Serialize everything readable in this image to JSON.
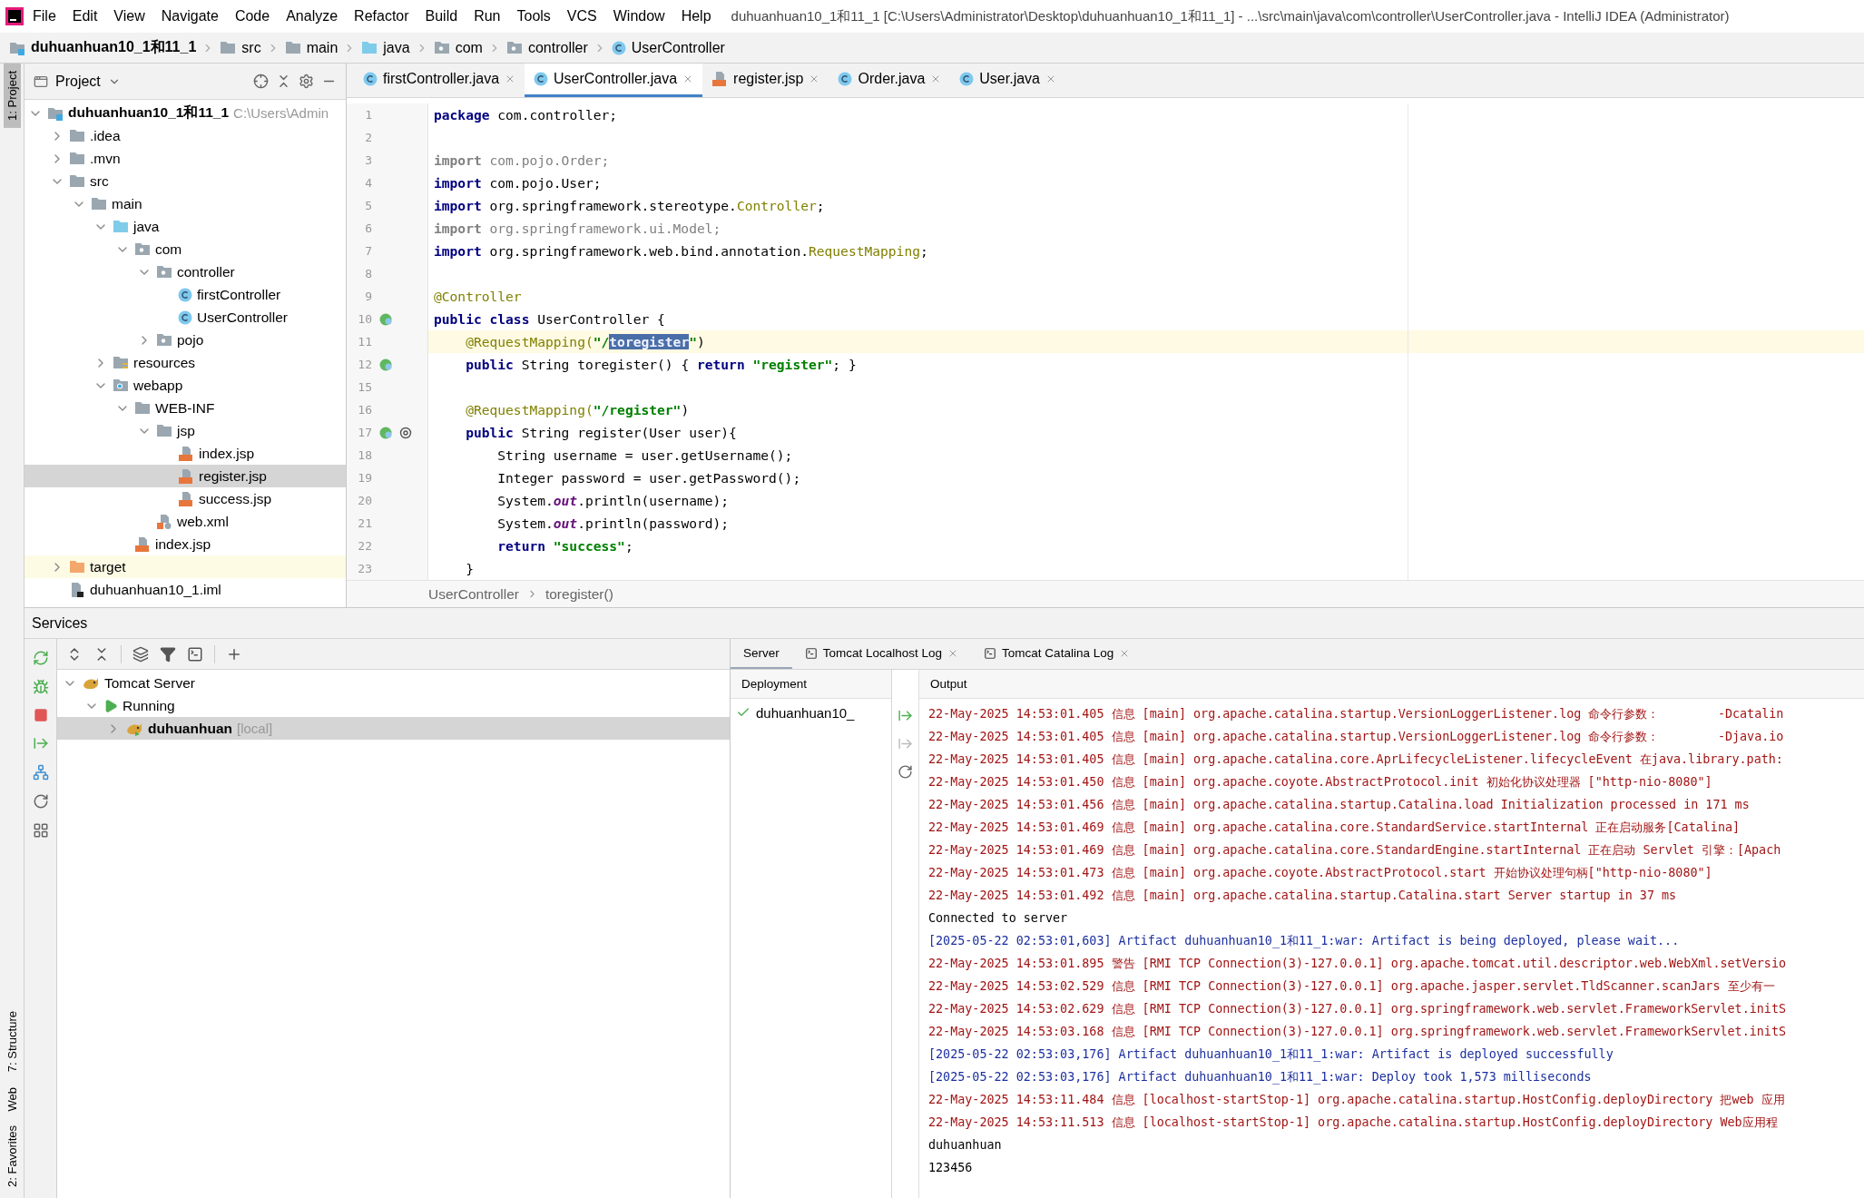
{
  "menu": [
    "File",
    "Edit",
    "View",
    "Navigate",
    "Code",
    "Analyze",
    "Refactor",
    "Build",
    "Run",
    "Tools",
    "VCS",
    "Window",
    "Help"
  ],
  "window": {
    "title": "duhuanhuan10_1和11_1 [C:\\Users\\Administrator\\Desktop\\duhuanhuan10_1和11_1] - ...\\src\\main\\java\\com\\controller\\UserController.java - IntelliJ IDEA (Administrator)"
  },
  "navbar": [
    {
      "label": "duhuanhuan10_1和11_1",
      "kind": "project"
    },
    {
      "label": "src",
      "kind": "folder"
    },
    {
      "label": "main",
      "kind": "folder"
    },
    {
      "label": "java",
      "kind": "src-folder"
    },
    {
      "label": "com",
      "kind": "package"
    },
    {
      "label": "controller",
      "kind": "package"
    },
    {
      "label": "UserController",
      "kind": "class"
    }
  ],
  "tool_stripe": [
    {
      "label": "1: Project",
      "selected": true
    },
    {
      "label": "7: Structure",
      "selected": false
    },
    {
      "label": "Web",
      "selected": false
    },
    {
      "label": "2: Favorites",
      "selected": false
    }
  ],
  "project": {
    "title": "Project",
    "tree": [
      {
        "label": "duhuanhuan10_1和11_1",
        "hint": "C:\\Users\\Admin",
        "kind": "project",
        "expanded": true,
        "selected": false,
        "children": [
          {
            "label": ".idea",
            "kind": "folder",
            "expanded": false,
            "selected": false
          },
          {
            "label": ".mvn",
            "kind": "folder",
            "expanded": false,
            "selected": false
          },
          {
            "label": "src",
            "kind": "folder",
            "expanded": true,
            "selected": false,
            "children": [
              {
                "label": "main",
                "kind": "folder",
                "expanded": true,
                "selected": false,
                "children": [
                  {
                    "label": "java",
                    "kind": "src-folder",
                    "expanded": true,
                    "selected": false,
                    "children": [
                      {
                        "label": "com",
                        "kind": "package",
                        "expanded": true,
                        "selected": false,
                        "children": [
                          {
                            "label": "controller",
                            "kind": "package",
                            "expanded": true,
                            "selected": false,
                            "children": [
                              {
                                "label": "firstController",
                                "kind": "class",
                                "selected": false
                              },
                              {
                                "label": "UserController",
                                "kind": "class",
                                "selected": false
                              }
                            ]
                          },
                          {
                            "label": "pojo",
                            "kind": "package",
                            "expanded": false,
                            "selected": false
                          }
                        ]
                      }
                    ]
                  },
                  {
                    "label": "resources",
                    "kind": "resources",
                    "expanded": false,
                    "selected": false
                  },
                  {
                    "label": "webapp",
                    "kind": "webapp",
                    "expanded": true,
                    "selected": false,
                    "children": [
                      {
                        "label": "WEB-INF",
                        "kind": "folder",
                        "expanded": true,
                        "selected": false,
                        "children": [
                          {
                            "label": "jsp",
                            "kind": "folder",
                            "expanded": true,
                            "selected": false,
                            "children": [
                              {
                                "label": "index.jsp",
                                "kind": "jsp",
                                "selected": false
                              },
                              {
                                "label": "register.jsp",
                                "kind": "jsp",
                                "selected": true
                              },
                              {
                                "label": "success.jsp",
                                "kind": "jsp",
                                "selected": false
                              }
                            ]
                          },
                          {
                            "label": "web.xml",
                            "kind": "xml",
                            "selected": false
                          }
                        ]
                      },
                      {
                        "label": "index.jsp",
                        "kind": "jsp",
                        "selected": false
                      }
                    ]
                  }
                ]
              }
            ]
          },
          {
            "label": "target",
            "kind": "excluded",
            "expanded": false,
            "selected": false
          },
          {
            "label": "duhuanhuan10_1.iml",
            "kind": "iml",
            "selected": false
          }
        ]
      }
    ]
  },
  "editor": {
    "tabs": [
      {
        "label": "firstController.java",
        "kind": "class",
        "selected": false
      },
      {
        "label": "UserController.java",
        "kind": "class",
        "selected": true
      },
      {
        "label": "register.jsp",
        "kind": "jsp",
        "selected": false
      },
      {
        "label": "Order.java",
        "kind": "class",
        "selected": false
      },
      {
        "label": "User.java",
        "kind": "class",
        "selected": false
      }
    ],
    "lines": [
      {
        "n": "1",
        "current": false,
        "tokens": [
          {
            "kind": "kw",
            "text": "package"
          },
          {
            "kind": "plain",
            "text": " com.controller;"
          }
        ]
      },
      {
        "n": "2",
        "current": false
      },
      {
        "n": "3",
        "current": false,
        "tokens": [
          {
            "kind": "kwdim",
            "text": "import"
          },
          {
            "kind": "dim",
            "text": " com.pojo.Order;"
          }
        ]
      },
      {
        "n": "4",
        "current": false,
        "tokens": [
          {
            "kind": "kw",
            "text": "import"
          },
          {
            "kind": "plain",
            "text": " com.pojo.User;"
          }
        ]
      },
      {
        "n": "5",
        "current": false,
        "tokens": [
          {
            "kind": "kw",
            "text": "import"
          },
          {
            "kind": "plain",
            "text": " org.springframework.stereotype."
          },
          {
            "kind": "cls",
            "text": "Controller"
          },
          {
            "kind": "plain",
            "text": ";"
          }
        ]
      },
      {
        "n": "6",
        "current": false,
        "tokens": [
          {
            "kind": "kwdim",
            "text": "import"
          },
          {
            "kind": "dim",
            "text": " org.springframework.ui.Model;"
          }
        ]
      },
      {
        "n": "7",
        "current": false,
        "tokens": [
          {
            "kind": "kw",
            "text": "import"
          },
          {
            "kind": "plain",
            "text": " org.springframework.web.bind.annotation."
          },
          {
            "kind": "cls",
            "text": "RequestMapping"
          },
          {
            "kind": "plain",
            "text": ";"
          }
        ]
      },
      {
        "n": "8",
        "current": false
      },
      {
        "n": "9",
        "current": false,
        "tokens": [
          {
            "kind": "ann",
            "text": "@Controller"
          }
        ]
      },
      {
        "n": "10",
        "current": false,
        "kind": "bean",
        "tokens": [
          {
            "kind": "kw",
            "text": "public class"
          },
          {
            "kind": "plain",
            "text": " UserController {"
          }
        ]
      },
      {
        "n": "11",
        "current": true,
        "tokens": [
          {
            "kind": "ann",
            "text": "    @RequestMapping("
          },
          {
            "kind": "str",
            "text": "\"/"
          },
          {
            "kind": "sel",
            "text": "toregister"
          },
          {
            "kind": "str",
            "text": "\""
          },
          {
            "kind": "plain",
            "text": ")"
          }
        ]
      },
      {
        "n": "12",
        "current": false,
        "kind": "bean",
        "tokens": [
          {
            "kind": "kw",
            "text": "    public"
          },
          {
            "kind": "plain",
            "text": " String toregister() { "
          },
          {
            "kind": "kw",
            "text": "return"
          },
          {
            "kind": "str",
            "text": " \"register\""
          },
          {
            "kind": "plain",
            "text": "; }"
          }
        ]
      },
      {
        "n": "15",
        "current": false
      },
      {
        "n": "16",
        "current": false,
        "tokens": [
          {
            "kind": "ann",
            "text": "    @RequestMapping("
          },
          {
            "kind": "str",
            "text": "\"/register\""
          },
          {
            "kind": "plain",
            "text": ")"
          }
        ]
      },
      {
        "n": "17",
        "current": false,
        "kind": "bean-at",
        "tokens": [
          {
            "kind": "kw",
            "text": "    public"
          },
          {
            "kind": "plain",
            "text": " String register(User user){"
          }
        ]
      },
      {
        "n": "18",
        "current": false,
        "tokens": [
          {
            "kind": "plain",
            "text": "        String username = user.getUsername();"
          }
        ]
      },
      {
        "n": "19",
        "current": false,
        "tokens": [
          {
            "kind": "plain",
            "text": "        Integer password = user.getPassword();"
          }
        ]
      },
      {
        "n": "20",
        "current": false,
        "tokens": [
          {
            "kind": "plain",
            "text": "        System."
          },
          {
            "kind": "field",
            "text": "out"
          },
          {
            "kind": "plain",
            "text": ".println(username);"
          }
        ]
      },
      {
        "n": "21",
        "current": false,
        "tokens": [
          {
            "kind": "plain",
            "text": "        System."
          },
          {
            "kind": "field",
            "text": "out"
          },
          {
            "kind": "plain",
            "text": ".println(password);"
          }
        ]
      },
      {
        "n": "22",
        "current": false,
        "tokens": [
          {
            "kind": "kw",
            "text": "        return"
          },
          {
            "kind": "str",
            "text": " \"success\""
          },
          {
            "kind": "plain",
            "text": ";"
          }
        ]
      },
      {
        "n": "23",
        "current": false,
        "tokens": [
          {
            "kind": "plain",
            "text": "    }"
          }
        ]
      }
    ],
    "breadcrumb": [
      "UserController",
      "toregister()"
    ]
  },
  "services": {
    "title": "Services",
    "tree": [
      {
        "label": "Tomcat Server",
        "kind": "server",
        "expanded": true,
        "selected": false,
        "children": [
          {
            "label": "Running",
            "kind": "running",
            "expanded": true,
            "selected": false,
            "children": [
              {
                "label": "duhuanhuan",
                "hint": "[local]",
                "kind": "instance",
                "expanded": false,
                "selected": true
              }
            ]
          }
        ]
      }
    ],
    "tabs": [
      {
        "label": "Server",
        "kind": "plain",
        "selected": true
      },
      {
        "label": "Tomcat Localhost Log",
        "kind": "log",
        "selected": false
      },
      {
        "label": "Tomcat Catalina Log",
        "kind": "log",
        "selected": false
      }
    ],
    "deployment_header": "Deployment",
    "output_header": "Output",
    "deployments": [
      {
        "label": "duhuanhuan10_",
        "ok": true
      }
    ],
    "log": [
      {
        "kind": "server",
        "text": "22-May-2025 14:53:01.405 信息 [main] org.apache.catalina.startup.VersionLoggerListener.log 命令行参数：        -Dcatalin"
      },
      {
        "kind": "server",
        "text": "22-May-2025 14:53:01.405 信息 [main] org.apache.catalina.startup.VersionLoggerListener.log 命令行参数：        -Djava.io"
      },
      {
        "kind": "server",
        "text": "22-May-2025 14:53:01.405 信息 [main] org.apache.catalina.core.AprLifecycleListener.lifecycleEvent 在java.library.path:"
      },
      {
        "kind": "server",
        "text": "22-May-2025 14:53:01.450 信息 [main] org.apache.coyote.AbstractProtocol.init 初始化协议处理器 [\"http-nio-8080\"]"
      },
      {
        "kind": "server",
        "text": "22-May-2025 14:53:01.456 信息 [main] org.apache.catalina.startup.Catalina.load Initialization processed in 171 ms"
      },
      {
        "kind": "server",
        "text": "22-May-2025 14:53:01.469 信息 [main] org.apache.catalina.core.StandardService.startInternal 正在启动服务[Catalina]"
      },
      {
        "kind": "server",
        "text": "22-May-2025 14:53:01.469 信息 [main] org.apache.catalina.core.StandardEngine.startInternal 正在启动 Servlet 引擎：[Apach"
      },
      {
        "kind": "server",
        "text": "22-May-2025 14:53:01.473 信息 [main] org.apache.coyote.AbstractProtocol.start 开始协议处理句柄[\"http-nio-8080\"]"
      },
      {
        "kind": "server",
        "text": "22-May-2025 14:53:01.492 信息 [main] org.apache.catalina.startup.Catalina.start Server startup in 37 ms"
      },
      {
        "kind": "stdout",
        "text": "Connected to server"
      },
      {
        "kind": "system",
        "text": "[2025-05-22 02:53:01,603] Artifact duhuanhuan10_1和11_1:war: Artifact is being deployed, please wait..."
      },
      {
        "kind": "server",
        "text": "22-May-2025 14:53:01.895 警告 [RMI TCP Connection(3)-127.0.0.1] org.apache.tomcat.util.descriptor.web.WebXml.setVersio"
      },
      {
        "kind": "server",
        "text": "22-May-2025 14:53:02.529 信息 [RMI TCP Connection(3)-127.0.0.1] org.apache.jasper.servlet.TldScanner.scanJars 至少有一"
      },
      {
        "kind": "server",
        "text": "22-May-2025 14:53:02.629 信息 [RMI TCP Connection(3)-127.0.0.1] org.springframework.web.servlet.FrameworkServlet.initS"
      },
      {
        "kind": "server",
        "text": "22-May-2025 14:53:03.168 信息 [RMI TCP Connection(3)-127.0.0.1] org.springframework.web.servlet.FrameworkServlet.initS"
      },
      {
        "kind": "system",
        "text": "[2025-05-22 02:53:03,176] Artifact duhuanhuan10_1和11_1:war: Artifact is deployed successfully"
      },
      {
        "kind": "system",
        "text": "[2025-05-22 02:53:03,176] Artifact duhuanhuan10_1和11_1:war: Deploy took 1,573 milliseconds"
      },
      {
        "kind": "server",
        "text": "22-May-2025 14:53:11.484 信息 [localhost-startStop-1] org.apache.catalina.startup.HostConfig.deployDirectory 把web 应用"
      },
      {
        "kind": "server",
        "text": "22-May-2025 14:53:11.513 信息 [localhost-startStop-1] org.apache.catalina.startup.HostConfig.deployDirectory Web应用程"
      },
      {
        "kind": "stdout",
        "text": "duhuanhuan"
      },
      {
        "kind": "stdout",
        "text": "123456"
      }
    ]
  }
}
